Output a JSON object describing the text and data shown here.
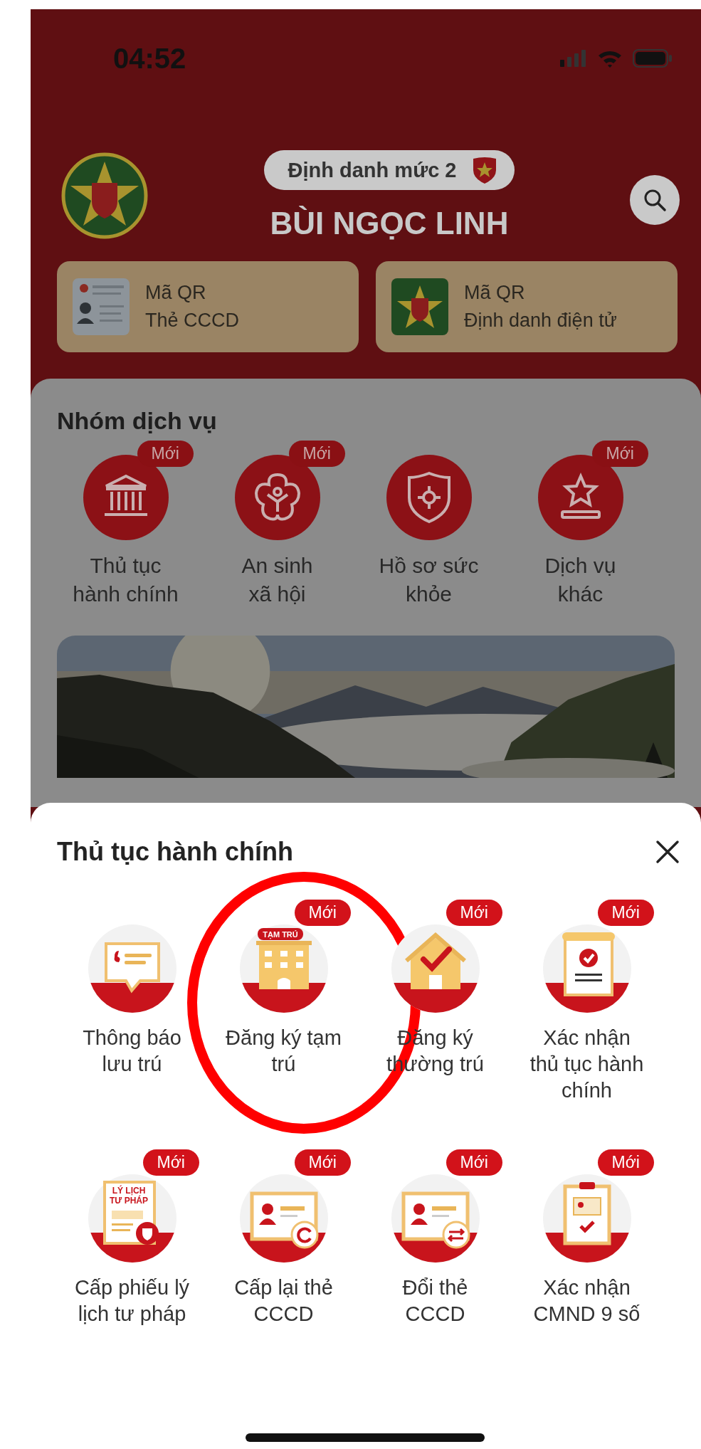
{
  "status_bar": {
    "time": "04:52"
  },
  "header": {
    "level_badge": "Định danh mức 2",
    "user_name": "BÙI NGỌC LINH"
  },
  "qr_cards": [
    {
      "kind": "id_card",
      "line1": "Mã QR",
      "line2": "Thẻ CCCD"
    },
    {
      "kind": "emblem",
      "line1": "Mã QR",
      "line2": "Định danh điện tử"
    }
  ],
  "service_group": {
    "title": "Nhóm dịch vụ",
    "items": [
      {
        "kind": "building",
        "label": "Thủ tục\nhành chính",
        "badge": "Mới"
      },
      {
        "kind": "flower",
        "label": "An sinh\nxã hội",
        "badge": "Mới"
      },
      {
        "kind": "shield",
        "label": "Hồ sơ sức\nkhỏe"
      },
      {
        "kind": "star",
        "label": "Dịch vụ\nkhác",
        "badge": "Mới"
      }
    ]
  },
  "sheet": {
    "title": "Thủ tục hành chính",
    "items": [
      {
        "kind": "notice",
        "label": "Thông báo\nlưu trú",
        "circled": false
      },
      {
        "kind": "temp_residence",
        "label": "Đăng ký tạm\ntrú",
        "badge": "Mới",
        "tag": "TẠM TRÚ",
        "circled": true
      },
      {
        "kind": "house",
        "label": "Đăng ký\nthường trú",
        "badge": "Mới",
        "circled": false
      },
      {
        "kind": "scroll",
        "label": "Xác nhận\nthủ tục hành\nchính",
        "badge": "Mới",
        "circled": false
      },
      {
        "kind": "record",
        "label": "Cấp phiếu lý\nlịch tư pháp",
        "badge": "Mới",
        "tag": "LÝ LỊCH",
        "tag2": "TƯ PHÁP",
        "circled": false
      },
      {
        "kind": "card_refresh",
        "label": "Cấp lại thẻ\nCCCD",
        "badge": "Mới",
        "circled": false
      },
      {
        "kind": "card_swap",
        "label": "Đổi thẻ\nCCCD",
        "badge": "Mới",
        "circled": false
      },
      {
        "kind": "clipboard",
        "label": "Xác nhận\nCMND 9 số",
        "badge": "Mới",
        "circled": false
      }
    ]
  }
}
